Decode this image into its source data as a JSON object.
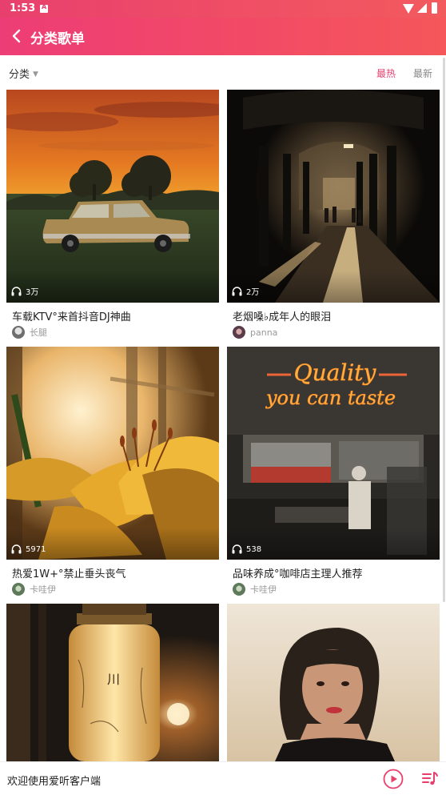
{
  "status_bar": {
    "time": "1:53"
  },
  "app_bar": {
    "title": "分类歌单"
  },
  "filter": {
    "category_label": "分类",
    "sort_hot": "最热",
    "sort_new": "最新",
    "active_sort": "hot"
  },
  "playlists": [
    {
      "name": "车载KTV°来首抖音DJ神曲",
      "author": "长腿",
      "play_count": "3万"
    },
    {
      "name": "老烟嗓♭成年人的眼泪",
      "author": "panna",
      "play_count": "2万"
    },
    {
      "name": "热爱1W+°禁止垂头丧气",
      "author": "卡哇伊",
      "play_count": "5971"
    },
    {
      "name": "品味养成°咖啡店主理人推荐",
      "author": "卡哇伊",
      "play_count": "538"
    },
    {
      "name": "",
      "author": "",
      "play_count": ""
    },
    {
      "name": "",
      "author": "",
      "play_count": ""
    }
  ],
  "neon_sign": {
    "line1": "Quality",
    "line2": "you can taste"
  },
  "bottom_bar": {
    "welcome_text": "欢迎使用爱听客户端"
  },
  "colors": {
    "accent": "#e8406e",
    "app_bar_start": "#ed3d76",
    "app_bar_end": "#f5575a"
  }
}
